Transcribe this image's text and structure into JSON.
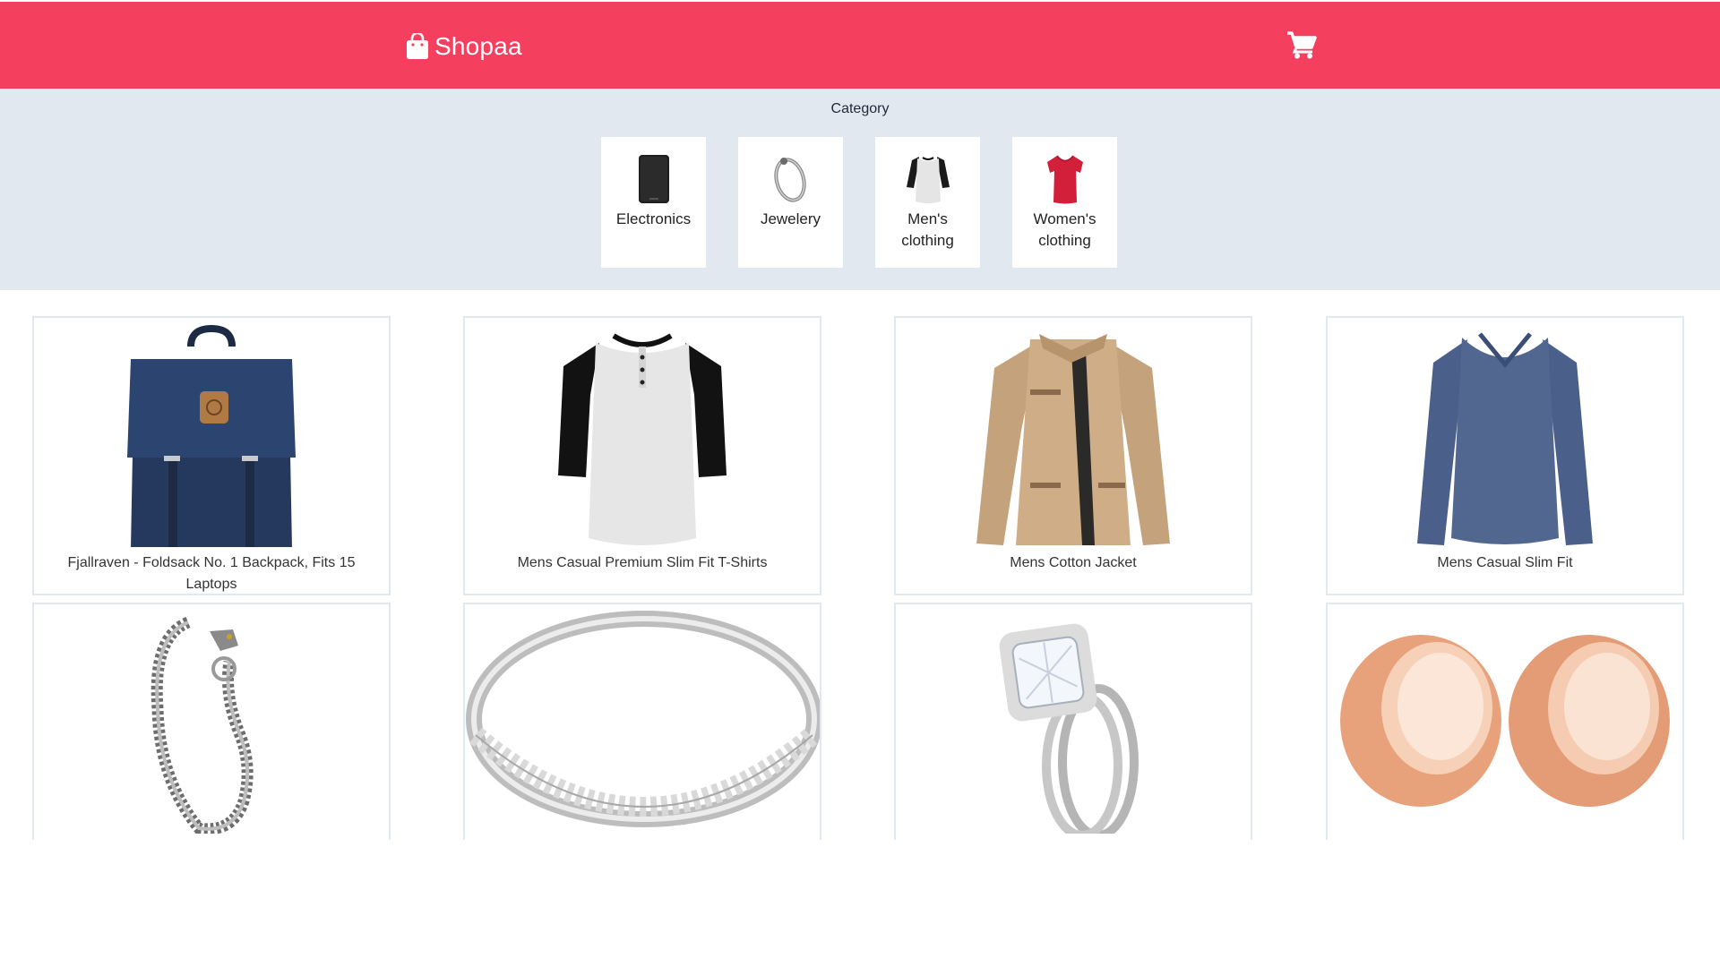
{
  "header": {
    "brand": "Shopaa",
    "brand_icon": "shopping-bag-icon",
    "cart_icon": "shopping-cart-icon",
    "background_color": "#f43f5e"
  },
  "categories": {
    "title": "Category",
    "items": [
      {
        "label": "Electronics",
        "icon": "external-drive-icon"
      },
      {
        "label": "Jewelery",
        "icon": "bracelet-icon"
      },
      {
        "label": "Men's clothing",
        "icon": "raglan-shirt-icon"
      },
      {
        "label": "Women's clothing",
        "icon": "red-tshirt-icon"
      }
    ]
  },
  "products": [
    {
      "title": "Fjallraven - Foldsack No. 1 Backpack, Fits 15 Laptops",
      "image": "navy-backpack"
    },
    {
      "title": "Mens Casual Premium Slim Fit T-Shirts",
      "image": "raglan-tshirt"
    },
    {
      "title": "Mens Cotton Jacket",
      "image": "khaki-jacket"
    },
    {
      "title": "Mens Casual Slim Fit",
      "image": "blue-long-sleeve-shirt"
    },
    {
      "title": "",
      "image": "dragon-chain-bracelet"
    },
    {
      "title": "",
      "image": "silver-eternity-ring"
    },
    {
      "title": "",
      "image": "halo-diamond-ring-set"
    },
    {
      "title": "",
      "image": "rose-gold-ear-tunnels"
    }
  ]
}
